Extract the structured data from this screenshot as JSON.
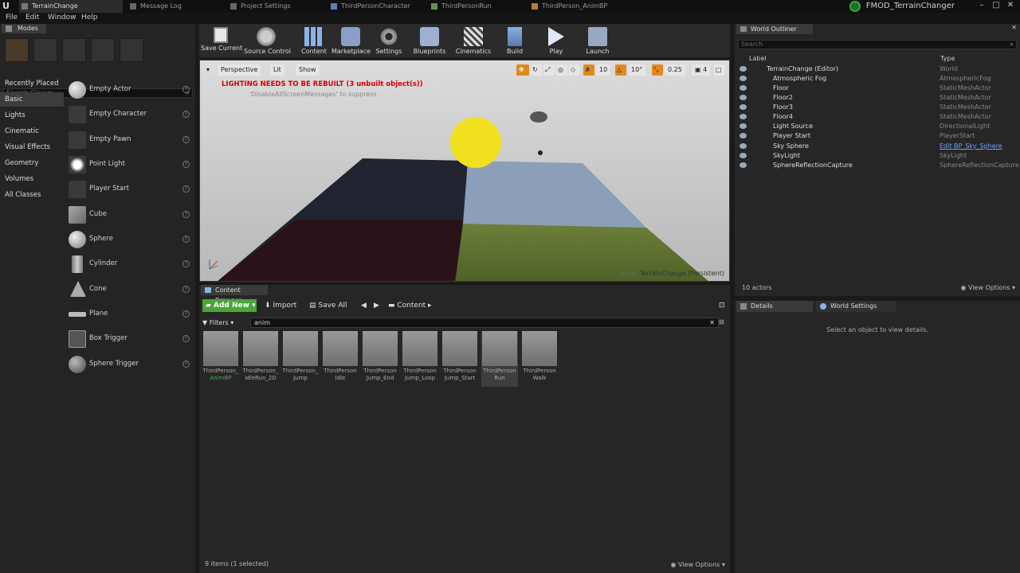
{
  "tabs": [
    {
      "label": "TerrainChange",
      "active": true
    },
    {
      "label": "Message Log",
      "active": false
    },
    {
      "label": "Project Settings",
      "active": false
    },
    {
      "label": "ThirdPersonCharacter",
      "active": false
    },
    {
      "label": "ThirdPersonRun",
      "active": false
    },
    {
      "label": "ThirdPerson_AnimBP",
      "active": false
    }
  ],
  "app_name": "FMOD_TerrainChanger",
  "menu": [
    "File",
    "Edit",
    "Window",
    "Help"
  ],
  "modes": {
    "tab_label": "Modes",
    "search_placeholder": "Search Classes",
    "categories": [
      "Recently Placed",
      "Basic",
      "Lights",
      "Cinematic",
      "Visual Effects",
      "Geometry",
      "Volumes",
      "All Classes"
    ],
    "selected_category": "Basic",
    "items": [
      "Empty Actor",
      "Empty Character",
      "Empty Pawn",
      "Point Light",
      "Player Start",
      "Cube",
      "Sphere",
      "Cylinder",
      "Cone",
      "Plane",
      "Box Trigger",
      "Sphere Trigger"
    ]
  },
  "toolbar": [
    "Save Current",
    "Source Control",
    "Content",
    "Marketplace",
    "Settings",
    "Blueprints",
    "Cinematics",
    "Build",
    "Play",
    "Launch"
  ],
  "viewport": {
    "perspective": "Perspective",
    "lit": "Lit",
    "show": "Show",
    "snap_translate": "10",
    "snap_rotate": "10°",
    "snap_scale": "0.25",
    "camera_speed": "4",
    "warning": "LIGHTING NEEDS TO BE REBUILT (3 unbuilt object(s))",
    "suppress": "'DisableAllScreenMessages' to suppress",
    "level_prefix": "Level:",
    "level_name": "TerrainChange (Persistent)"
  },
  "content_browser": {
    "tab_label": "Content Browser",
    "add_new": "Add New",
    "import": "Import",
    "save_all": "Save All",
    "path": "Content",
    "filters": "Filters",
    "search_value": "anim",
    "assets": [
      {
        "name1": "ThirdPerson_",
        "name2": "AnimBP"
      },
      {
        "name1": "ThirdPerson_",
        "name2": "IdleRun_2D"
      },
      {
        "name1": "ThirdPerson_",
        "name2": "Jump"
      },
      {
        "name1": "ThirdPerson",
        "name2": "Idle"
      },
      {
        "name1": "ThirdPerson",
        "name2": "Jump_End"
      },
      {
        "name1": "ThirdPerson",
        "name2": "Jump_Loop"
      },
      {
        "name1": "ThirdPerson",
        "name2": "Jump_Start"
      },
      {
        "name1": "ThirdPerson",
        "name2": "Run"
      },
      {
        "name1": "ThirdPerson",
        "name2": "Walk"
      }
    ],
    "status": "9 items (1 selected)",
    "view_options": "View Options"
  },
  "outliner": {
    "tab_label": "World Outliner",
    "search_placeholder": "Search",
    "col_label": "Label",
    "col_type": "Type",
    "rows": [
      {
        "label": "TerrainChange (Editor)",
        "type": "World"
      },
      {
        "label": "Atmospheric Fog",
        "type": "AtmosphericFog"
      },
      {
        "label": "Floor",
        "type": "StaticMeshActor"
      },
      {
        "label": "Floor2",
        "type": "StaticMeshActor"
      },
      {
        "label": "Floor3",
        "type": "StaticMeshActor"
      },
      {
        "label": "Floor4",
        "type": "StaticMeshActor"
      },
      {
        "label": "Light Source",
        "type": "DirectionalLight"
      },
      {
        "label": "Player Start",
        "type": "PlayerStart"
      },
      {
        "label": "Sky Sphere",
        "type": "Edit BP_Sky_Sphere"
      },
      {
        "label": "SkyLight",
        "type": "SkyLight"
      },
      {
        "label": "SphereReflectionCapture",
        "type": "SphereReflectionCapture"
      }
    ],
    "count": "10 actors",
    "view_options": "View Options"
  },
  "details": {
    "tab_details": "Details",
    "tab_world": "World Settings",
    "empty_text": "Select an object to view details."
  },
  "colors": {
    "accent_green": "#4aa63a",
    "warning_red": "#d40000",
    "link_blue": "#6ea0ff"
  }
}
